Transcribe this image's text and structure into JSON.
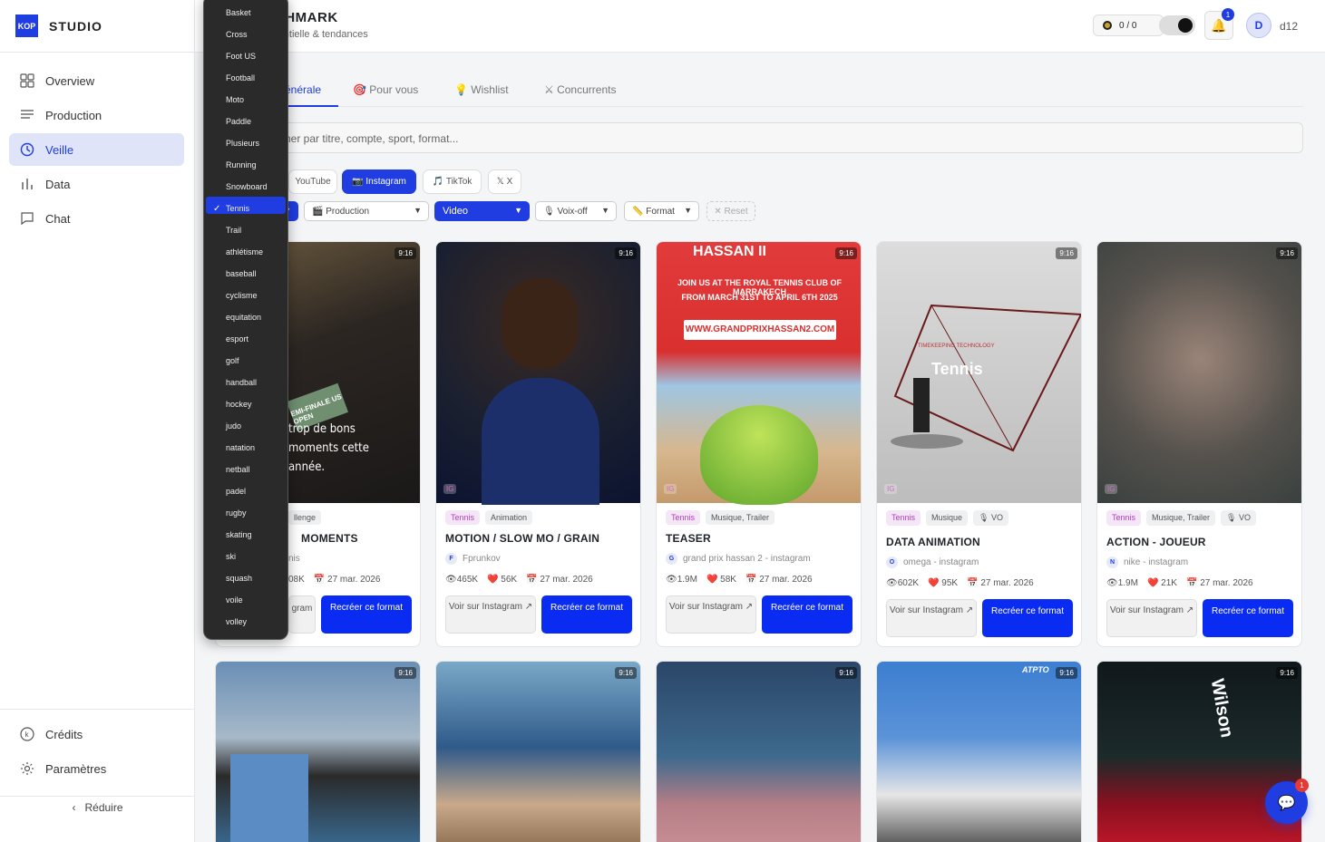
{
  "sidebar": {
    "logo_badge": "KOP",
    "logo_text": "STUDIO",
    "items": [
      {
        "label": "Overview"
      },
      {
        "label": "Production"
      },
      {
        "label": "Veille"
      },
      {
        "label": "Data"
      },
      {
        "label": "Chat"
      }
    ],
    "bottom": [
      {
        "label": "Crédits"
      },
      {
        "label": "Paramètres"
      }
    ],
    "reduce": "Réduire"
  },
  "header": {
    "title": "CHMARK",
    "subtitle": "rentielle & tendances",
    "credits": "0 / 0",
    "notif_count": "1",
    "avatar": "D",
    "username": "d12"
  },
  "tabs": [
    {
      "label": "énérale"
    },
    {
      "label": "Pour vous"
    },
    {
      "label": "Wishlist"
    },
    {
      "label": "Concurrents"
    }
  ],
  "search": {
    "placeholder": "her par titre, compte, sport, format..."
  },
  "platforms": [
    {
      "label": "YouTube"
    },
    {
      "label": "Instagram"
    },
    {
      "label": "TikTok"
    },
    {
      "label": "X"
    }
  ],
  "filters": {
    "production": "Production",
    "content_type": "Video",
    "voiceover": "Voix-off",
    "format": "Format",
    "reset": "Reset"
  },
  "sport_menu": {
    "selected": "Tennis",
    "options": [
      "Basket",
      "Cross",
      "Foot US",
      "Football",
      "Moto",
      "Paddle",
      "Plusieurs",
      "Running",
      "Snowboard",
      "Tennis",
      "Trail",
      "athlétisme",
      "baseball",
      "cyclisme",
      "equitation",
      "esport",
      "golf",
      "handball",
      "hockey",
      "judo",
      "natation",
      "netball",
      "padel",
      "rugby",
      "skating",
      "ski",
      "squash",
      "voile",
      "volley"
    ]
  },
  "cards": [
    {
      "ratio": "9:16",
      "tags": [
        "llenge"
      ],
      "title": "MOMENTS",
      "account": "nis",
      "avatar": "",
      "views": "",
      "likes": "08K",
      "date": "27 mar. 2026",
      "btn_view": "gram",
      "btn_recreate": "Recréer ce format",
      "overlay_text": "trop de bons moments cette année.",
      "badge_text": "EMI-FINALE US OPEN",
      "ig": ""
    },
    {
      "ratio": "9:16",
      "tags": [
        "Tennis",
        "Animation"
      ],
      "title": "MOTION / SLOW MO / GRAIN",
      "account": "Fprunkov",
      "avatar": "F",
      "views": "465K",
      "likes": "56K",
      "date": "27 mar. 2026",
      "btn_view": "Voir sur Instagram ↗",
      "btn_recreate": "Recréer ce format",
      "ig": "IG"
    },
    {
      "ratio": "9:16",
      "tags": [
        "Tennis",
        "Musique, Trailer"
      ],
      "title": "TEASER",
      "account": "grand prix hassan 2 - instagram",
      "avatar": "G",
      "views": "1.9M",
      "likes": "58K",
      "date": "27 mar. 2026",
      "btn_view": "Voir sur Instagram ↗",
      "btn_recreate": "Recréer ce format",
      "poster": {
        "top": "HASSAN II",
        "line1": "JOIN US AT THE ROYAL TENNIS CLUB OF MARRAKECH",
        "line2": "FROM MARCH 31ST TO APRIL 6TH 2025",
        "url": "WWW.GRANDPRIXHASSAN2.COM"
      },
      "ig": "IG"
    },
    {
      "ratio": "9:16",
      "tags": [
        "Tennis",
        "Musique",
        "VO"
      ],
      "title": "DATA ANIMATION",
      "account": "omega - instagram",
      "avatar": "O",
      "views": "602K",
      "likes": "95K",
      "date": "27 mar. 2026",
      "btn_view": "Voir sur Instagram ↗",
      "btn_recreate": "Recréer ce format",
      "overlay": {
        "brand": "TIMEKEEPING TECHNOLOGY",
        "word": "Tennis"
      },
      "ig": "IG"
    },
    {
      "ratio": "9:16",
      "tags": [
        "Tennis",
        "Musique, Trailer",
        "VO"
      ],
      "title": "ACTION - JOUEUR",
      "account": "nike - instagram",
      "avatar": "N",
      "views": "1.9M",
      "likes": "21K",
      "date": "27 mar. 2026",
      "btn_view": "Voir sur Instagram ↗",
      "btn_recreate": "Recréer ce format",
      "ig": "IG"
    }
  ],
  "row2": [
    {
      "ratio": "9:16"
    },
    {
      "ratio": "9:16"
    },
    {
      "ratio": "9:16"
    },
    {
      "ratio": "9:16",
      "brand": "ATPTO"
    },
    {
      "ratio": "9:16",
      "brand": "Wilson"
    }
  ],
  "chat_fab": {
    "badge": "1"
  }
}
